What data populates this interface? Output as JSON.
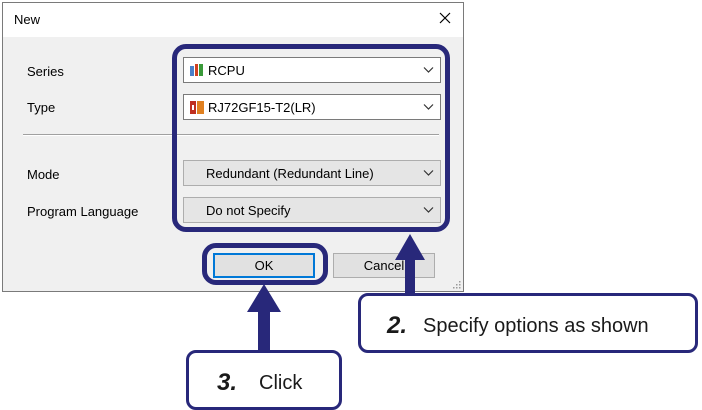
{
  "dialog": {
    "title": "New",
    "close_icon": "close-icon",
    "fields": {
      "series_label": "Series",
      "series_value": "RCPU",
      "series_icon": "cpu-module-icon",
      "type_label": "Type",
      "type_value": "RJ72GF15-T2(LR)",
      "type_icon": "network-module-icon",
      "mode_label": "Mode",
      "mode_value": "Redundant (Redundant Line)",
      "language_label": "Program Language",
      "language_value": "Do not Specify"
    },
    "buttons": {
      "ok": "OK",
      "cancel": "Cancel"
    }
  },
  "callouts": {
    "step2_num": "2.",
    "step2_text": "Specify options as shown",
    "step3_num": "3.",
    "step3_text": "Click"
  },
  "colors": {
    "callout_border": "#28287a",
    "focus_blue": "#0078d7",
    "dialog_bg": "#f0f0f0"
  }
}
